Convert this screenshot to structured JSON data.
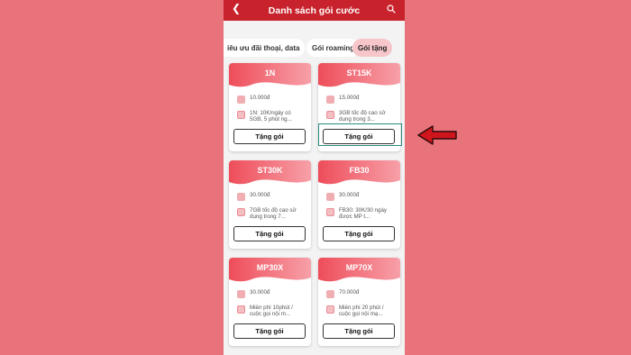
{
  "header": {
    "back_icon": "chevron-left-icon",
    "title": "Danh sách gói cước",
    "search_icon": "search-icon"
  },
  "tabs": [
    {
      "label": "iêu ưu đãi thoại, data",
      "active": false
    },
    {
      "label": "Gói roaming",
      "active": false
    },
    {
      "label": "Gói tặng",
      "active": true
    }
  ],
  "packages": [
    {
      "name": "1N",
      "price": "10.000đ",
      "desc": "1N: 10K/ngày có 5GB, 5 phút ng...",
      "button": "Tặng gói"
    },
    {
      "name": "ST15K",
      "price": "15.000đ",
      "desc": "3GB tốc độ cao sử dụng trong 3...",
      "button": "Tặng gói"
    },
    {
      "name": "ST30K",
      "price": "30.000đ",
      "desc": "7GB tốc độ cao sử dụng trong 7...",
      "button": "Tặng gói"
    },
    {
      "name": "FB30",
      "price": "30.000đ",
      "desc": "FB30: 30K/30 ngày được MP t...",
      "button": "Tặng gói"
    },
    {
      "name": "MP30X",
      "price": "30.000đ",
      "desc": "Miễn phí 10phút / cuộc gọi nội m...",
      "button": "Tặng gói"
    },
    {
      "name": "MP70X",
      "price": "70.000đ",
      "desc": "Miễn phí 20 phút / cuộc gọi nội mạ...",
      "button": "Tặng gói"
    }
  ],
  "annotation": {
    "arrow_color": "#d0151d",
    "highlight_color": "#2c8a80",
    "arrow_icon": "arrow-left-icon"
  },
  "colors": {
    "background": "#e8737b",
    "header": "#c8232c",
    "active_tab": "#f6c6ca"
  }
}
